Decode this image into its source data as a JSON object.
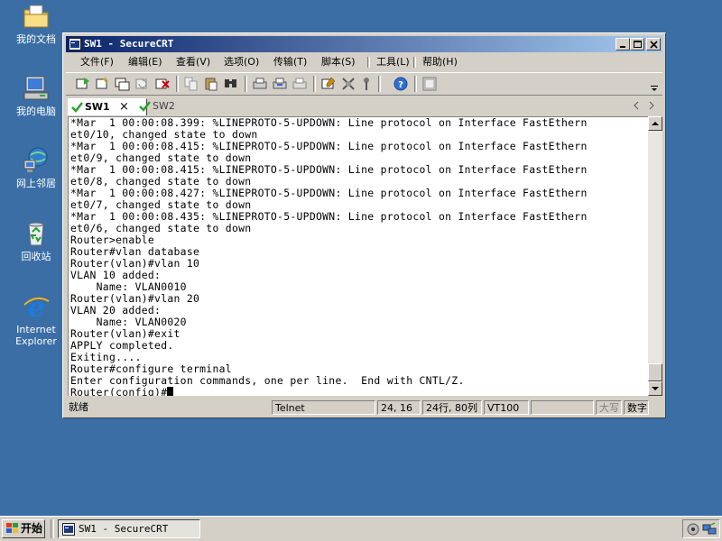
{
  "desktop": {
    "icons": [
      {
        "label": "我的文档",
        "icon": "folder-icon"
      },
      {
        "label": "我的电脑",
        "icon": "computer-icon"
      },
      {
        "label": "网上邻居",
        "icon": "network-icon"
      },
      {
        "label": "回收站",
        "icon": "recycle-bin-icon"
      },
      {
        "label": "Internet\nExplorer",
        "icon": "ie-icon"
      }
    ]
  },
  "window": {
    "title": "SW1 - SecureCRT",
    "menu": [
      "文件(F)",
      "编辑(E)",
      "查看(V)",
      "选项(O)",
      "传输(T)",
      "脚本(S)",
      "工具(L)",
      "帮助(H)"
    ],
    "tabs": [
      {
        "label": "SW1",
        "active": true
      },
      {
        "label": "SW2",
        "active": false
      }
    ],
    "tab_close": "×",
    "terminal_lines": [
      "*Mar  1 00:00:08.399: %LINEPROTO-5-UPDOWN: Line protocol on Interface FastEthern",
      "et0/10, changed state to down",
      "*Mar  1 00:00:08.415: %LINEPROTO-5-UPDOWN: Line protocol on Interface FastEthern",
      "et0/9, changed state to down",
      "*Mar  1 00:00:08.415: %LINEPROTO-5-UPDOWN: Line protocol on Interface FastEthern",
      "et0/8, changed state to down",
      "*Mar  1 00:00:08.427: %LINEPROTO-5-UPDOWN: Line protocol on Interface FastEthern",
      "et0/7, changed state to down",
      "*Mar  1 00:00:08.435: %LINEPROTO-5-UPDOWN: Line protocol on Interface FastEthern",
      "et0/6, changed state to down",
      "Router>enable",
      "Router#vlan database",
      "Router(vlan)#vlan 10",
      "VLAN 10 added:",
      "    Name: VLAN0010",
      "Router(vlan)#vlan 20",
      "VLAN 20 added:",
      "    Name: VLAN0020",
      "Router(vlan)#exit",
      "APPLY completed.",
      "Exiting....",
      "Router#configure terminal",
      "Enter configuration commands, one per line.  End with CNTL/Z."
    ],
    "prompt": "Router(config)#",
    "status": {
      "ready": "就绪",
      "protocol": "Telnet",
      "cursor_pos": "24, 16",
      "dimensions": "24行, 80列",
      "emulation": "VT100",
      "blank": "",
      "caps": "大写",
      "num": "数字"
    }
  },
  "taskbar": {
    "start_label": "开始",
    "task_label": "SW1 - SecureCRT"
  },
  "colors": {
    "desktop": "#3a6ea5",
    "title_start": "#0a246a",
    "title_end": "#a6caf0",
    "chrome": "#d4d0c8"
  }
}
